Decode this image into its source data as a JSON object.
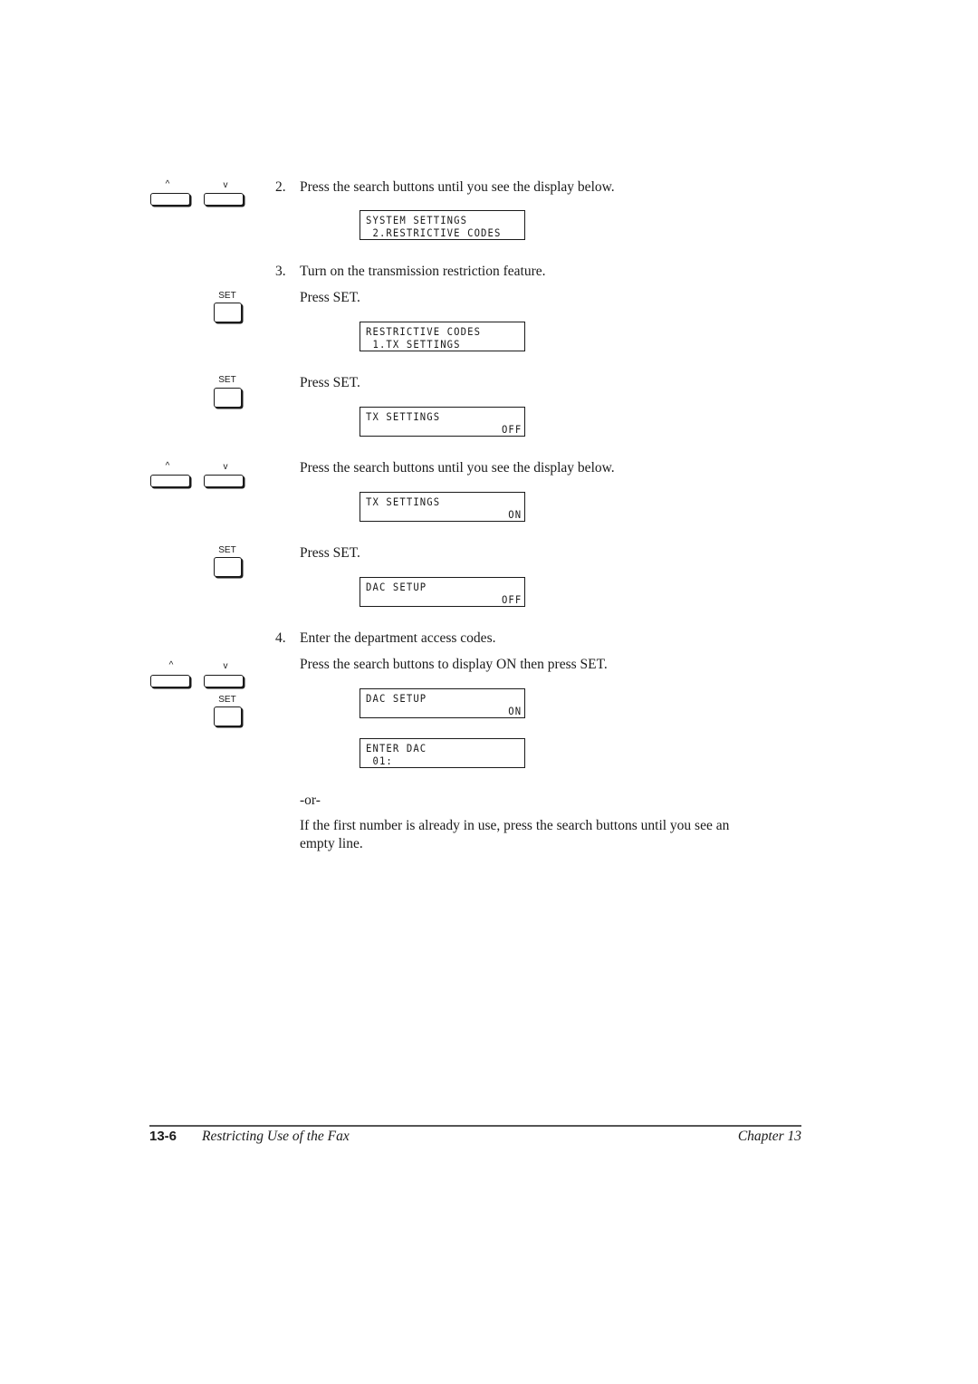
{
  "keys": {
    "up_label": "^",
    "down_label": "v",
    "set_label": "SET"
  },
  "steps": [
    {
      "number": "2.",
      "paragraphs": [
        "Press the search buttons until you see the display below."
      ],
      "display": {
        "line1": "SYSTEM SETTINGS",
        "line2": " 2.RESTRICTIVE CODES",
        "line2_right": ""
      }
    },
    {
      "number": "3.",
      "paragraphs": [
        "Turn on the transmission restriction feature.",
        "Press SET."
      ],
      "display": {
        "line1": "RESTRICTIVE CODES",
        "line2": " 1.TX SETTINGS",
        "line2_right": ""
      }
    },
    {
      "number": "",
      "paragraphs": [
        "Press SET."
      ],
      "display": {
        "line1": "TX SETTINGS",
        "line2": "",
        "line2_right": "OFF"
      }
    },
    {
      "number": "",
      "paragraphs": [
        "Press the search buttons until you see the display below."
      ],
      "display": {
        "line1": "TX SETTINGS",
        "line2": "",
        "line2_right": "ON"
      }
    },
    {
      "number": "",
      "paragraphs": [
        "Press SET."
      ],
      "display": {
        "line1": "DAC SETUP",
        "line2": "",
        "line2_right": "OFF"
      }
    },
    {
      "number": "4.",
      "paragraphs": [
        "Enter the department access codes.",
        "Press the search buttons to display ON then press SET."
      ],
      "displays": [
        {
          "line1": "DAC SETUP",
          "line2": "",
          "line2_right": "ON"
        },
        {
          "line1": "ENTER DAC",
          "line2": " 01:",
          "line2_right": ""
        }
      ],
      "or_text": "-or-",
      "note": "If the first number is already in use, press the search buttons until you see an",
      "note_cont": "empty line."
    }
  ],
  "footer": {
    "page_number": "13-6",
    "section_title": "Restricting Use of the Fax",
    "chapter": "Chapter 13"
  }
}
